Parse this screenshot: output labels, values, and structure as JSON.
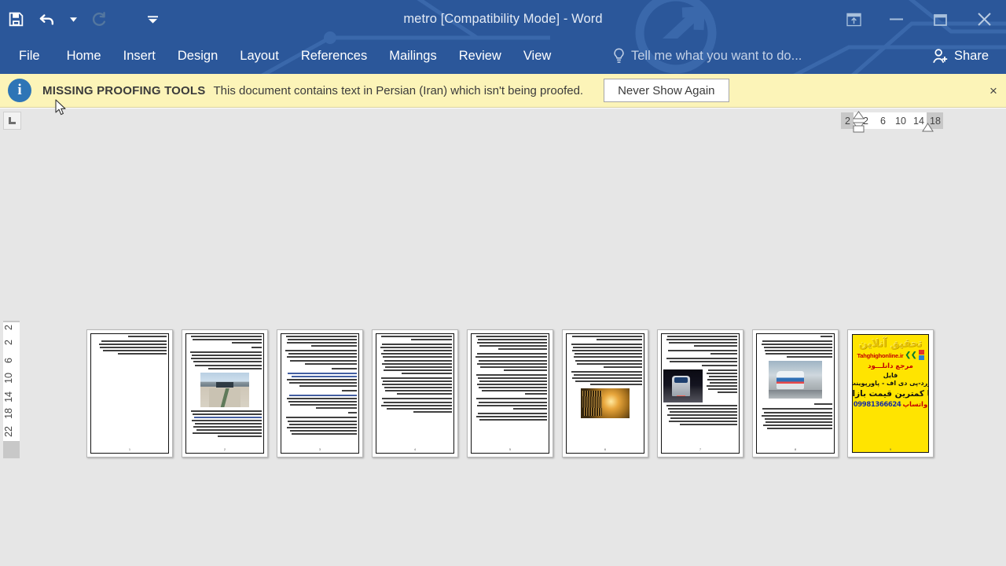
{
  "window": {
    "title": "metro [Compatibility Mode] - Word",
    "accent_color": "#2b579a",
    "controls": [
      {
        "name": "ribbon-display-options",
        "glyph": "ribbon"
      },
      {
        "name": "minimize",
        "glyph": "minimize"
      },
      {
        "name": "restore",
        "glyph": "restore"
      },
      {
        "name": "close",
        "glyph": "close"
      }
    ]
  },
  "quick_access": {
    "items": [
      {
        "name": "save",
        "label": "Save",
        "enabled": true
      },
      {
        "name": "undo",
        "label": "Undo",
        "enabled": true,
        "has_dropdown": true
      },
      {
        "name": "redo",
        "label": "Redo",
        "enabled": false
      },
      {
        "name": "customize-quick-access-toolbar",
        "label": "Customize Quick Access Toolbar",
        "enabled": true
      }
    ]
  },
  "ribbon": {
    "tabs": [
      {
        "label": "File",
        "active": false
      },
      {
        "label": "Home",
        "active": false
      },
      {
        "label": "Insert",
        "active": false
      },
      {
        "label": "Design",
        "active": false
      },
      {
        "label": "Layout",
        "active": false
      },
      {
        "label": "References",
        "active": false
      },
      {
        "label": "Mailings",
        "active": false
      },
      {
        "label": "Review",
        "active": false
      },
      {
        "label": "View",
        "active": false
      }
    ],
    "tell_me_placeholder": "Tell me what you want to do...",
    "share_label": "Share"
  },
  "message_bar": {
    "title": "MISSING PROOFING TOOLS",
    "text": "This document contains text in Persian (Iran) which isn't being proofed.",
    "button_label": "Never Show Again",
    "close_label": "×",
    "background_color": "#fcf4b8"
  },
  "rulers": {
    "tab_stop_type": "L",
    "horizontal_ticks": [
      "2",
      "2",
      "6",
      "10",
      "14",
      "18"
    ],
    "vertical_ticks": [
      "2",
      "2",
      "6",
      "10",
      "14",
      "18",
      "22"
    ]
  },
  "document": {
    "name": "metro",
    "page_count": 9,
    "view": "multiple-pages-zoomed-out",
    "language": "Persian (Iran)",
    "pages": [
      {
        "number": "1",
        "kind": "text",
        "page_label": "1"
      },
      {
        "number": "2",
        "kind": "text-image",
        "image": "road-photo",
        "page_label": "2"
      },
      {
        "number": "3",
        "kind": "text",
        "page_label": "3"
      },
      {
        "number": "4",
        "kind": "text",
        "page_label": "4"
      },
      {
        "number": "5",
        "kind": "text",
        "page_label": "5"
      },
      {
        "number": "6",
        "kind": "text-image",
        "image": "golden-photo",
        "page_label": "6"
      },
      {
        "number": "7",
        "kind": "text-image",
        "image": "dark-train-photo",
        "page_label": "7"
      },
      {
        "number": "8",
        "kind": "text-image",
        "image": "platform-train-photo",
        "page_label": "8"
      },
      {
        "number": "9",
        "kind": "advertisement",
        "page_label": "9"
      }
    ]
  },
  "advertisement": {
    "title": "تحقیق آنلاین",
    "url": "Tahghighonline.ir",
    "line1": "مرجع دانلـــود",
    "line2": "فایل",
    "line3": "ورد-پی دی اف - پاورپوینت",
    "line4": "با کمترین قیمت بازار",
    "phone": "09981366624",
    "phone_label": "واتساپ",
    "background_color": "#ffe400"
  }
}
